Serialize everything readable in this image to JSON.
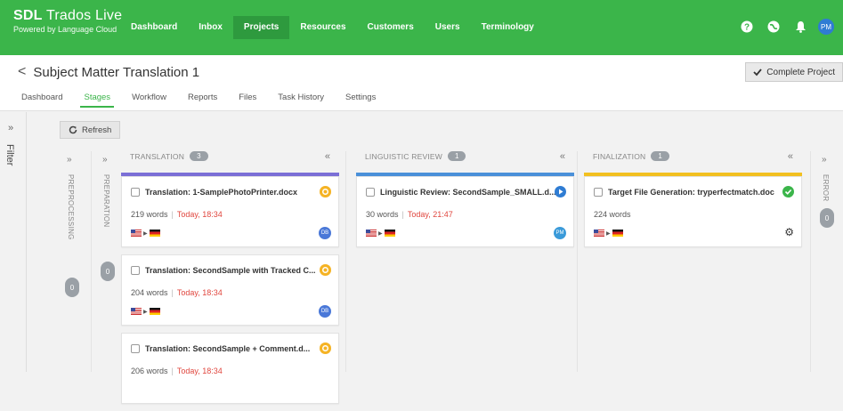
{
  "brand": {
    "name_bold": "SDL",
    "name_light": " Trados Live",
    "subtitle": "Powered by Language Cloud"
  },
  "nav": [
    "Dashboard",
    "Inbox",
    "Projects",
    "Resources",
    "Customers",
    "Users",
    "Terminology"
  ],
  "nav_active": "Projects",
  "user_initials": "PM",
  "page": {
    "back_glyph": "<",
    "title": "Subject Matter Translation 1",
    "complete_button": "Complete Project",
    "tabs": [
      "Dashboard",
      "Stages",
      "Workflow",
      "Reports",
      "Files",
      "Task History",
      "Settings"
    ],
    "active_tab": "Stages"
  },
  "filter_label": "Filter",
  "refresh_label": "Refresh",
  "collapsed_stages": [
    {
      "label": "PREPROCESSING",
      "count": "0"
    },
    {
      "label": "PREPARATION",
      "count": "0"
    },
    {
      "label": "ERROR",
      "count": "0"
    }
  ],
  "stages": [
    {
      "title": "TRANSLATION",
      "count": "3",
      "bar_color": "#7b6fd6",
      "cards": [
        {
          "title": "Translation: 1-SamplePhotoPrinter.docx",
          "words": "219 words",
          "date": "Today, 18:34",
          "status_color": "#f5b324",
          "assignee": "DB",
          "assignee_color": "#4a78d8"
        },
        {
          "title": "Translation: SecondSample with Tracked C...",
          "words": "204 words",
          "date": "Today, 18:34",
          "status_color": "#f5b324",
          "assignee": "DB",
          "assignee_color": "#4a78d8"
        },
        {
          "title": "Translation: SecondSample + Comment.d...",
          "words": "206 words",
          "date": "Today, 18:34",
          "status_color": "#f5b324",
          "assignee": "",
          "assignee_color": "#4a78d8"
        }
      ]
    },
    {
      "title": "LINGUISTIC REVIEW",
      "count": "1",
      "bar_color": "#4a90d9",
      "cards": [
        {
          "title": "Linguistic Review: SecondSample_SMALL.d...",
          "words": "30 words",
          "date": "Today, 21:47",
          "status_color": "#2f7cd3",
          "assignee": "PM",
          "assignee_color": "#3a9ad9"
        }
      ]
    },
    {
      "title": "FINALIZATION",
      "count": "1",
      "bar_color": "#f2c020",
      "cards": [
        {
          "title": "Target File Generation: tryperfectmatch.doc",
          "words": "224 words",
          "date": "",
          "status_color": "#3bb54a",
          "assignee": "",
          "assignee_color": ""
        }
      ]
    }
  ],
  "flag_arrow": "▶",
  "colors": {
    "brand_green": "#3bb54a",
    "nav_active": "#2e9a3e",
    "date_red": "#e0463e"
  }
}
